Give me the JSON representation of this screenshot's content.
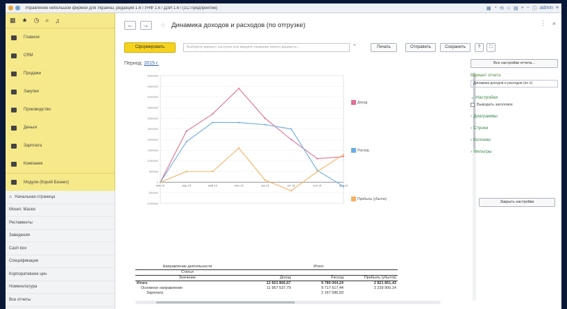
{
  "window": {
    "title": "Управление небольшой фирмой для Украины, редакция 1.6 / УНФ 1.6 / ДЗИ 1.6 / (1С:Предприятие)",
    "user": "admin"
  },
  "sidebar": {
    "items": [
      {
        "label": "Главное",
        "icon": "home-icon"
      },
      {
        "label": "CRM",
        "icon": "crm-icon"
      },
      {
        "label": "Продажи",
        "icon": "cart-icon"
      },
      {
        "label": "Закупки",
        "icon": "truck-icon"
      },
      {
        "label": "Производство",
        "icon": "factory-icon"
      },
      {
        "label": "Деньги",
        "icon": "money-icon"
      },
      {
        "label": "Зарплата",
        "icon": "people-icon"
      },
      {
        "label": "Компания",
        "icon": "flag-icon"
      },
      {
        "label": "Модули (Корей Бизнес)",
        "icon": "modules-icon"
      }
    ],
    "links": [
      "Начальная страница",
      "Монит. Маски",
      "Регламенты",
      "Заведения",
      "Cash box",
      "Спецификации",
      "Корпоративное цен",
      "Номенклатура",
      "Все отчеты"
    ]
  },
  "header": {
    "back": "←",
    "forward": "→",
    "title": "Динамика доходов и расходов (по отгрузке)"
  },
  "toolbar": {
    "generate": "Сформировать",
    "variant_placeholder": "Выберите вариант настроек или введите название нового варианта...",
    "print": "Печать",
    "send": "Отправить",
    "save": "Сохранить",
    "help": "?",
    "expand": "⛶"
  },
  "period": {
    "label": "Период:",
    "value": "2015 г."
  },
  "chart_data": {
    "type": "line",
    "categories": [
      "янв 15",
      "мар 15",
      "май 15",
      "июл 15",
      "сен 15",
      "окт 15",
      "ноя 15",
      "дек 15"
    ],
    "series": [
      {
        "name": "Доход",
        "color": "#e07090",
        "values": [
          0,
          2400000,
          3200000,
          4400000,
          3000000,
          2000000,
          1100000,
          1200000
        ]
      },
      {
        "name": "Расход",
        "color": "#6aaee0",
        "values": [
          0,
          1900000,
          2800000,
          2800000,
          2700000,
          2500000,
          550000,
          -200000
        ]
      },
      {
        "name": "Прибыль (убыток)",
        "color": "#f5b060",
        "values": [
          0,
          500000,
          500000,
          1600000,
          100000,
          -400000,
          500000,
          1300000
        ]
      }
    ],
    "yticks": [
      "5000000",
      "4500000",
      "4000000",
      "3500000",
      "3000000",
      "2500000",
      "2000000",
      "1500000",
      "1000000",
      "500000",
      "0",
      "-500000",
      "-1000000"
    ],
    "ylim": [
      -1000000,
      5000000
    ]
  },
  "table": {
    "group_header": "Направление деятельности",
    "sub_header": "Статья",
    "col_item": "Значение",
    "col_group": "Итого",
    "col_income": "Доход",
    "col_expense": "Расход",
    "col_profit": "Прибыль (убыток)",
    "rows": [
      {
        "name": "Итого",
        "income": "12 601 866,67",
        "expense": "9 780 004,24",
        "profit": "2 821 851,43",
        "bold": true
      },
      {
        "name": "Основное направление",
        "income": "11 957 537,79",
        "expense": "9 717 617,44",
        "profit": "2 239 900,14",
        "bold": false
      },
      {
        "name": "Зарплата",
        "income": "",
        "expense": "2 167 586,83",
        "profit": "",
        "bold": false
      }
    ]
  },
  "right_panel": {
    "all_settings": "Все настройки отчета...",
    "variant_label": "Вариант отчета",
    "variant_value": "Динамика доходов и расходов (по о)",
    "settings": "Настройки",
    "show_header": "Выводить заголовок",
    "diagrams": "Диаграммы",
    "rows": "Строки",
    "columns": "Колонки",
    "filters": "Фильтры",
    "close_settings": "Закрыть настройки"
  },
  "colors": {
    "sidebar_bg": "#f6e98a",
    "accent_yellow": "#f5d21d",
    "link_green": "#3a8a4a"
  }
}
